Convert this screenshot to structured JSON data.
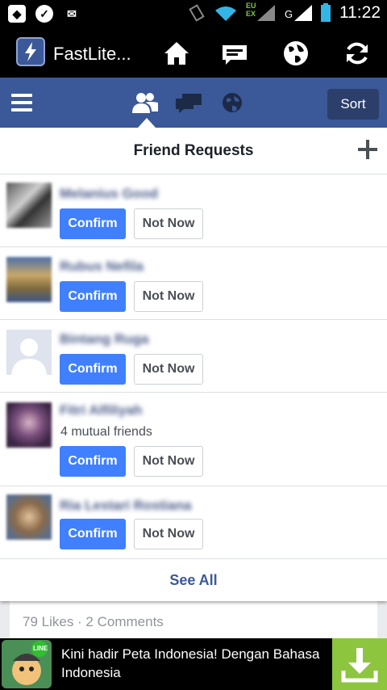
{
  "status_bar": {
    "time": "11:22",
    "network_top": "EU",
    "network_bottom": "EX",
    "network_g": "G"
  },
  "app_bar": {
    "title": "FastLite...",
    "actions": [
      "home-icon",
      "messages-icon",
      "globe-icon",
      "refresh-icon"
    ]
  },
  "fb_nav": {
    "sort_label": "Sort",
    "tabs": [
      "friend-requests-icon",
      "messages-icon",
      "notifications-globe-icon"
    ]
  },
  "panel": {
    "title": "Friend Requests",
    "requests": [
      {
        "name": "Melanius Good",
        "mutual": "",
        "confirm": "Confirm",
        "not_now": "Not Now"
      },
      {
        "name": "Rubus Nefila",
        "mutual": "",
        "confirm": "Confirm",
        "not_now": "Not Now"
      },
      {
        "name": "Bintang Ruga",
        "mutual": "",
        "confirm": "Confirm",
        "not_now": "Not Now"
      },
      {
        "name": "Fitri Alfiliyah",
        "mutual": "4 mutual friends",
        "confirm": "Confirm",
        "not_now": "Not Now"
      },
      {
        "name": "Ria Lestari Rostiana",
        "mutual": "",
        "confirm": "Confirm",
        "not_now": "Not Now"
      }
    ],
    "see_all": "See All"
  },
  "feed": {
    "stats": "79 Likes · 2 Comments"
  },
  "ad": {
    "badge": "LINE",
    "text": "Kini hadir Peta Indonesia! Dengan Bahasa Indonesia"
  }
}
